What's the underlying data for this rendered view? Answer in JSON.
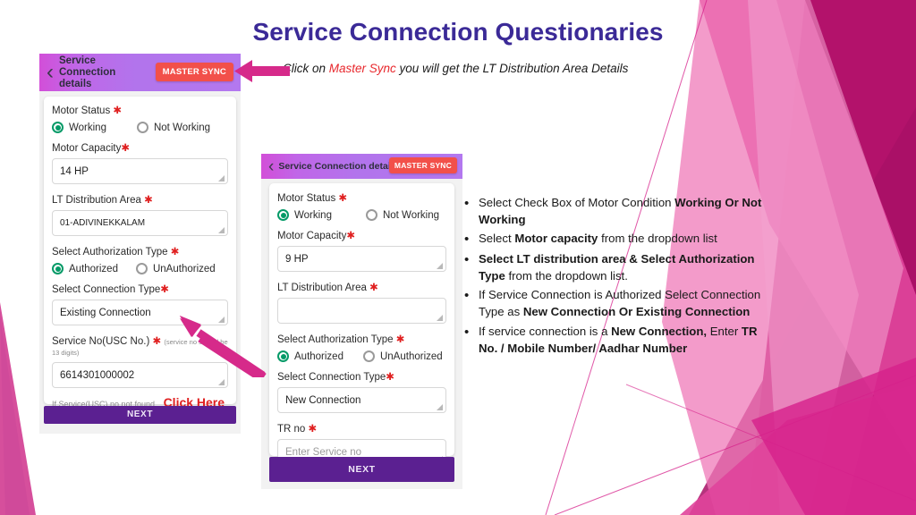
{
  "slide": {
    "title": "Service Connection Questionaries",
    "caption_prefix": "Click on ",
    "caption_highlight": "Master Sync",
    "caption_suffix": " you will get the LT Distribution Area Details"
  },
  "colors": {
    "title": "#3b2a97",
    "accent_red": "#e8272c",
    "master_sync_bg": "#f2504a",
    "header_gradient_start": "#d24fd8",
    "header_gradient_end": "#b378ef",
    "next_button": "#5b2091",
    "radio_selected": "#049a67",
    "arrow": "#d62a8a",
    "deco_pink": "#e0449b",
    "deco_magenta": "#b3126b"
  },
  "phone1": {
    "header_title": "Service Connection details",
    "back_icon": "chevron-left-icon",
    "master_sync_label": "MASTER SYNC",
    "fields": {
      "motor_status_label": "Motor Status",
      "motor_status_options": [
        "Working",
        "Not Working"
      ],
      "motor_status_selected": "Working",
      "motor_capacity_label": "Motor Capacity",
      "motor_capacity_value": "14 HP",
      "lt_area_label": "LT Distribution Area",
      "lt_area_value": "01-ADIVINEKKALAM",
      "auth_type_label": "Select Authorization Type",
      "auth_type_options": [
        "Authorized",
        "UnAuthorized"
      ],
      "auth_type_selected": "Authorized",
      "connection_type_label": "Select Connection Type",
      "connection_type_value": "Existing Connection",
      "service_no_label": "Service No(USC No.)",
      "service_no_hint": "(service no should be 13 digits)",
      "service_no_value": "6614301000002",
      "not_found_text": "If Service(USC) no not found.",
      "click_here_label": "Click Here"
    },
    "next_label": "NEXT"
  },
  "phone2": {
    "header_title": "Service Connection details",
    "back_icon": "chevron-left-icon",
    "master_sync_label": "MASTER SYNC",
    "fields": {
      "motor_status_label": "Motor Status",
      "motor_status_options": [
        "Working",
        "Not Working"
      ],
      "motor_status_selected": "Working",
      "motor_capacity_label": "Motor Capacity",
      "motor_capacity_value": "9 HP",
      "lt_area_label": "LT Distribution Area",
      "lt_area_value": "",
      "auth_type_label": "Select Authorization Type",
      "auth_type_options": [
        "Authorized",
        "UnAuthorized"
      ],
      "auth_type_selected": "Authorized",
      "connection_type_label": "Select Connection Type",
      "connection_type_value": "New Connection",
      "tr_no_label": "TR no",
      "tr_no_placeholder": "Enter Service no",
      "tr_no_value": ""
    },
    "next_label": "NEXT"
  },
  "bullets": [
    {
      "parts": [
        {
          "t": "Select Check Box of Motor Condition ",
          "b": false
        },
        {
          "t": "Working Or Not Working",
          "b": true
        }
      ]
    },
    {
      "parts": [
        {
          "t": "Select ",
          "b": false
        },
        {
          "t": "Motor capacity",
          "b": true
        },
        {
          "t": " from the dropdown list",
          "b": false
        }
      ]
    },
    {
      "parts": [
        {
          "t": "Select LT distribution area & Select Authorization Type",
          "b": true
        },
        {
          "t": " from the dropdown list.",
          "b": false
        }
      ]
    },
    {
      "parts": [
        {
          "t": "If Service Connection is Authorized Select Connection Type as ",
          "b": false
        },
        {
          "t": "New Connection Or Existing Connection",
          "b": true
        }
      ]
    },
    {
      "parts": [
        {
          "t": "If service connection is a ",
          "b": false
        },
        {
          "t": "New Connection,",
          "b": true
        },
        {
          "t": " Enter ",
          "b": false
        },
        {
          "t": "TR No. / Mobile Number/ Aadhar Number",
          "b": true
        }
      ]
    }
  ]
}
